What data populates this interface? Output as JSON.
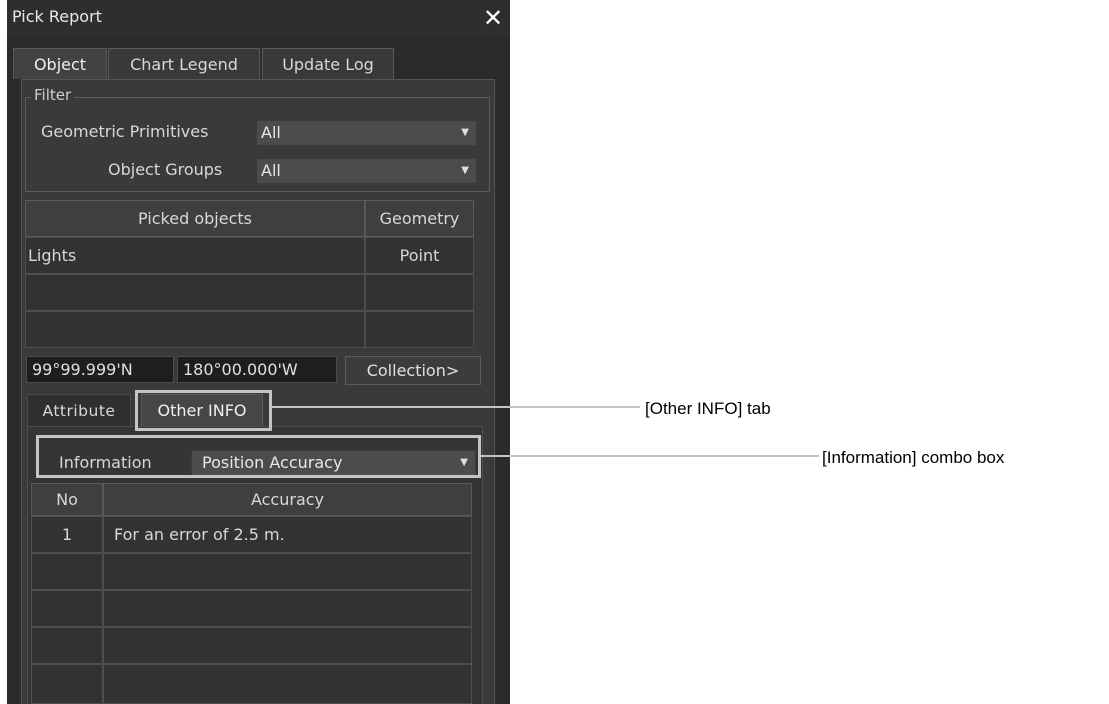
{
  "window": {
    "title": "Pick Report",
    "close_label": "✕"
  },
  "tabs": [
    {
      "label": "Object",
      "active": true
    },
    {
      "label": "Chart Legend",
      "active": false
    },
    {
      "label": "Update Log",
      "active": false
    }
  ],
  "filter": {
    "legend": "Filter",
    "geometric_primitives": {
      "label": "Geometric Primitives",
      "value": "All"
    },
    "object_groups": {
      "label": "Object Groups",
      "value": "All"
    }
  },
  "picked_table": {
    "headers": [
      "Picked objects",
      "Geometry"
    ],
    "rows": [
      [
        "Lights",
        "Point"
      ],
      [
        "",
        ""
      ],
      [
        "",
        ""
      ]
    ]
  },
  "position": {
    "lat": "99°99.999'N",
    "lon": "180°00.000'W"
  },
  "collection_button": "Collection>",
  "subtabs": [
    {
      "label": "Attribute",
      "active": false
    },
    {
      "label": "Other INFO",
      "active": true
    }
  ],
  "information": {
    "label": "Information",
    "value": "Position Accuracy"
  },
  "accuracy_table": {
    "headers": [
      "No",
      "Accuracy"
    ],
    "rows": [
      [
        "1",
        "For an error of 2.5 m."
      ],
      [
        "",
        ""
      ],
      [
        "",
        ""
      ],
      [
        "",
        ""
      ],
      [
        "",
        ""
      ]
    ]
  },
  "callouts": {
    "other_info_tab": "[Other INFO]  tab",
    "information_combo": "[Information]  combo box"
  },
  "colors": {
    "panel_bg": "#2b2b2b",
    "highlight": "#c4c4c4"
  },
  "icons": {
    "dropdown": "chevron-down-icon",
    "close": "close-icon"
  }
}
